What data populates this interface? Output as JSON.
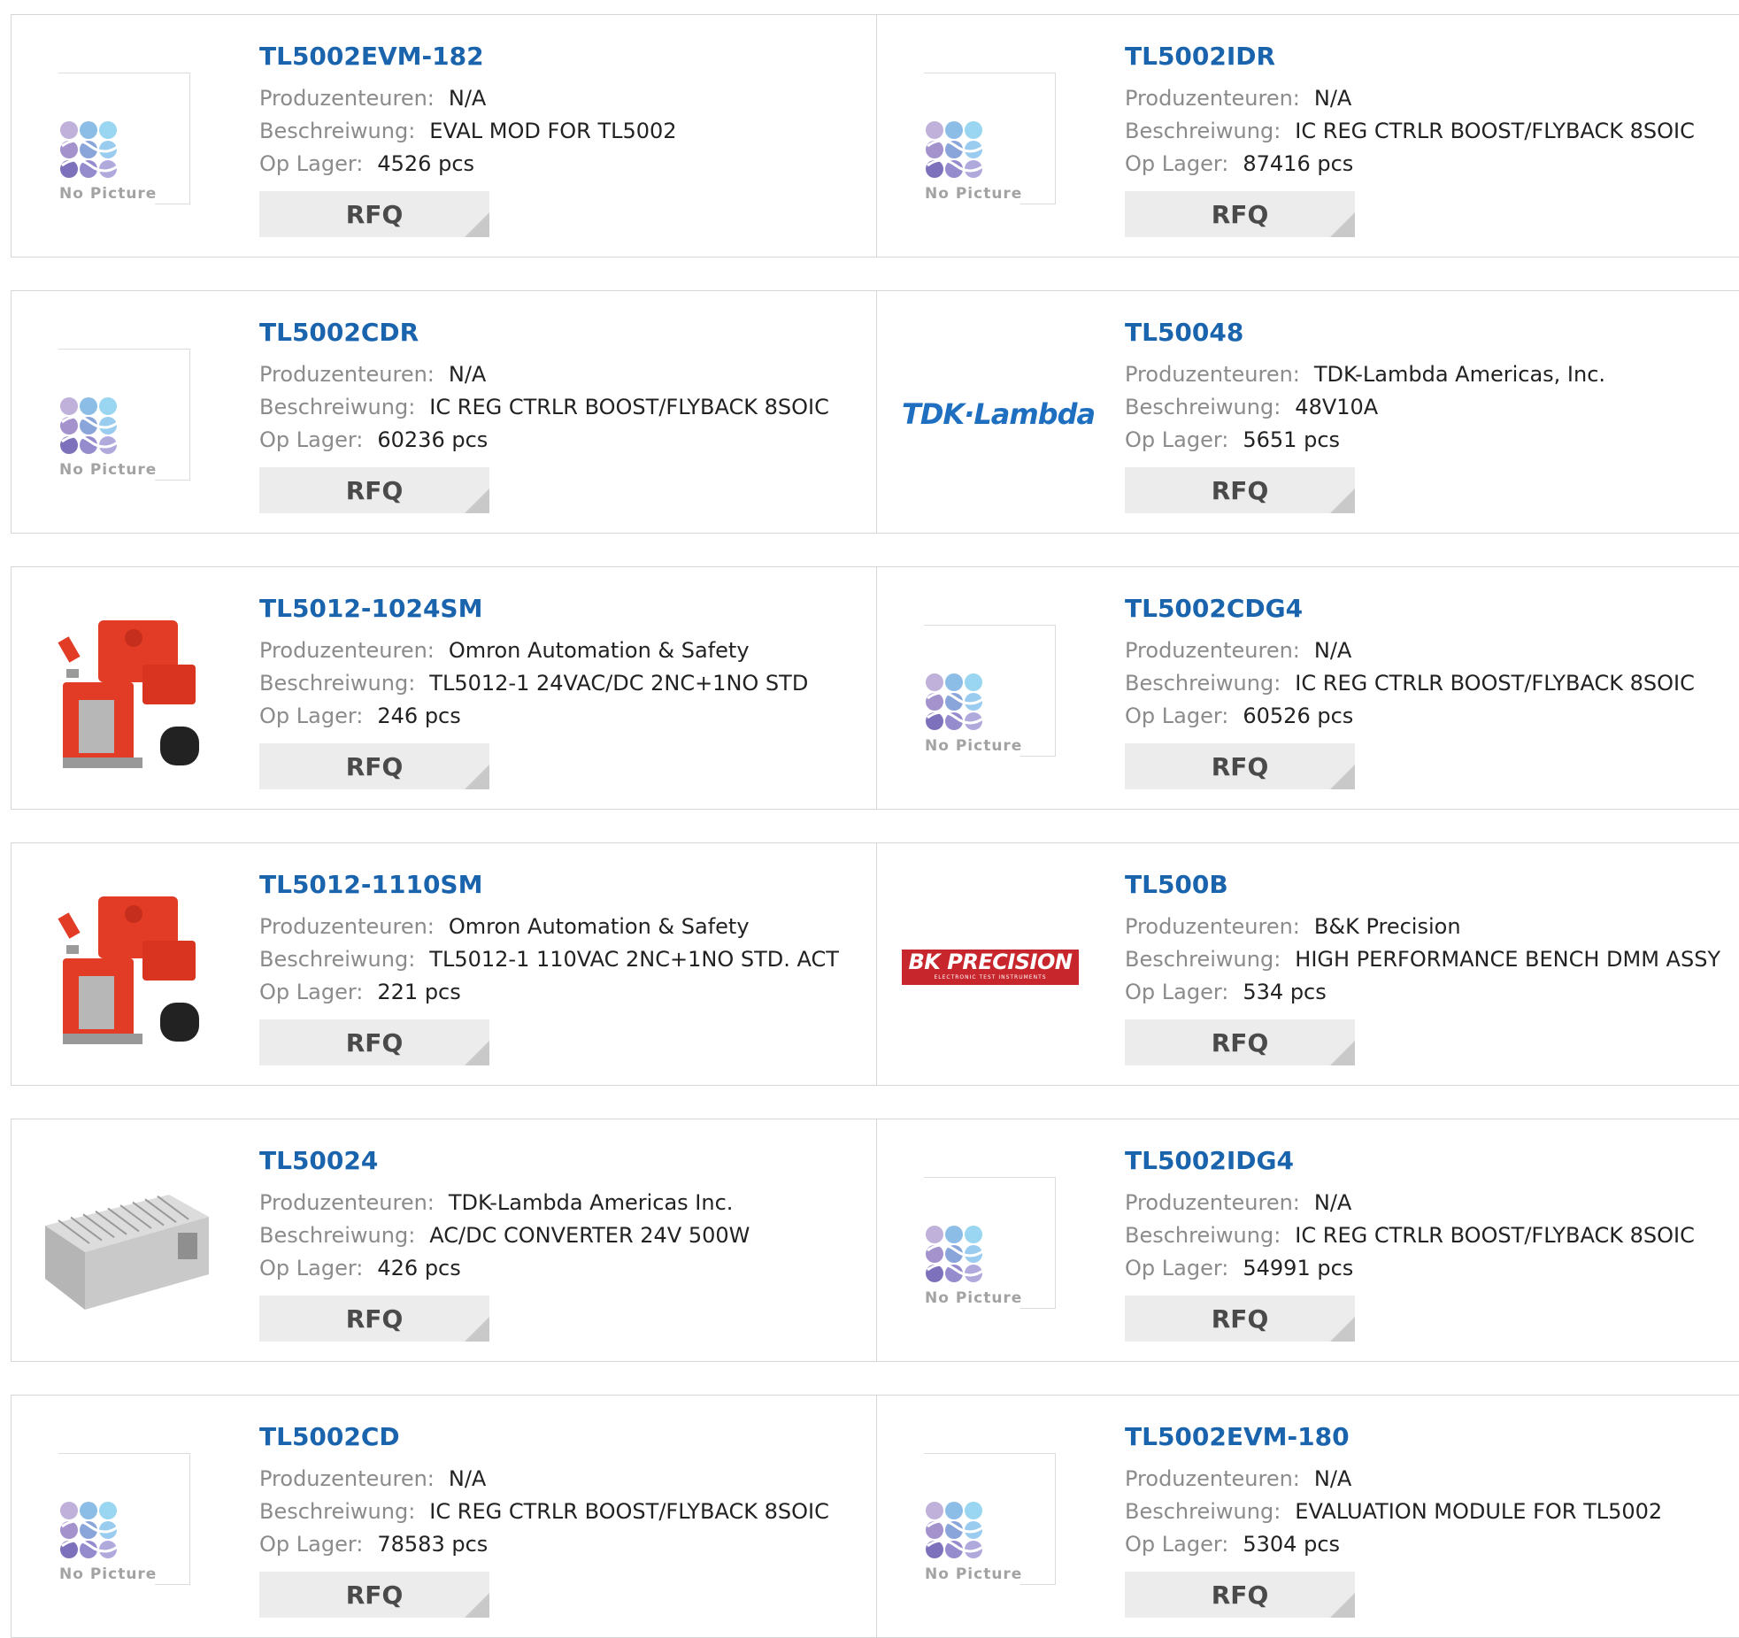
{
  "labels": {
    "manufacturer": "Produzenteuren:",
    "description": "Beschreiwung:",
    "stock": "Op Lager:",
    "rfq": "RFQ",
    "no_picture": "No Picture"
  },
  "colors": {
    "title_link": "#1a64ad",
    "label_gray": "#8b8b8b",
    "button_bg": "#ececec",
    "tdk_blue": "#1f6fc0",
    "bk_red": "#c8262d"
  },
  "products": [
    {
      "part": "TL5002EVM-182",
      "manufacturer": "N/A",
      "description": "EVAL MOD FOR TL5002",
      "stock": "4526 pcs",
      "image": "no-picture"
    },
    {
      "part": "TL5002IDR",
      "manufacturer": "N/A",
      "description": "IC REG CTRLR BOOST/FLYBACK 8SOIC",
      "stock": "87416 pcs",
      "image": "no-picture"
    },
    {
      "part": "TL5002CDR",
      "manufacturer": "N/A",
      "description": "IC REG CTRLR BOOST/FLYBACK 8SOIC",
      "stock": "60236 pcs",
      "image": "no-picture"
    },
    {
      "part": "TL50048",
      "manufacturer": "TDK-Lambda Americas, Inc.",
      "description": "48V10A",
      "stock": "5651 pcs",
      "image": "tdk-lambda-logo",
      "brand_text": "TDK·Lambda"
    },
    {
      "part": "TL5012-1024SM",
      "manufacturer": "Omron Automation & Safety",
      "description": "TL5012-1 24VAC/DC 2NC+1NO STD",
      "stock": "246 pcs",
      "image": "safety-switch-photo"
    },
    {
      "part": "TL5002CDG4",
      "manufacturer": "N/A",
      "description": "IC REG CTRLR BOOST/FLYBACK 8SOIC",
      "stock": "60526 pcs",
      "image": "no-picture"
    },
    {
      "part": "TL5012-1110SM",
      "manufacturer": "Omron Automation & Safety",
      "description": "TL5012-1 110VAC 2NC+1NO STD. ACT",
      "stock": "221 pcs",
      "image": "safety-switch-photo"
    },
    {
      "part": "TL500B",
      "manufacturer": "B&K Precision",
      "description": "HIGH PERFORMANCE BENCH DMM ASSY",
      "stock": "534 pcs",
      "image": "bk-precision-logo",
      "brand_text": "BK PRECISION",
      "brand_sub": "ELECTRONIC TEST INSTRUMENTS"
    },
    {
      "part": "TL50024",
      "manufacturer": "TDK-Lambda Americas Inc.",
      "description": "AC/DC CONVERTER 24V 500W",
      "stock": "426 pcs",
      "image": "power-supply-photo"
    },
    {
      "part": "TL5002IDG4",
      "manufacturer": "N/A",
      "description": "IC REG CTRLR BOOST/FLYBACK 8SOIC",
      "stock": "54991 pcs",
      "image": "no-picture"
    },
    {
      "part": "TL5002CD",
      "manufacturer": "N/A",
      "description": "IC REG CTRLR BOOST/FLYBACK 8SOIC",
      "stock": "78583 pcs",
      "image": "no-picture"
    },
    {
      "part": "TL5002EVM-180",
      "manufacturer": "N/A",
      "description": "EVALUATION MODULE FOR TL5002",
      "stock": "5304 pcs",
      "image": "no-picture"
    }
  ]
}
